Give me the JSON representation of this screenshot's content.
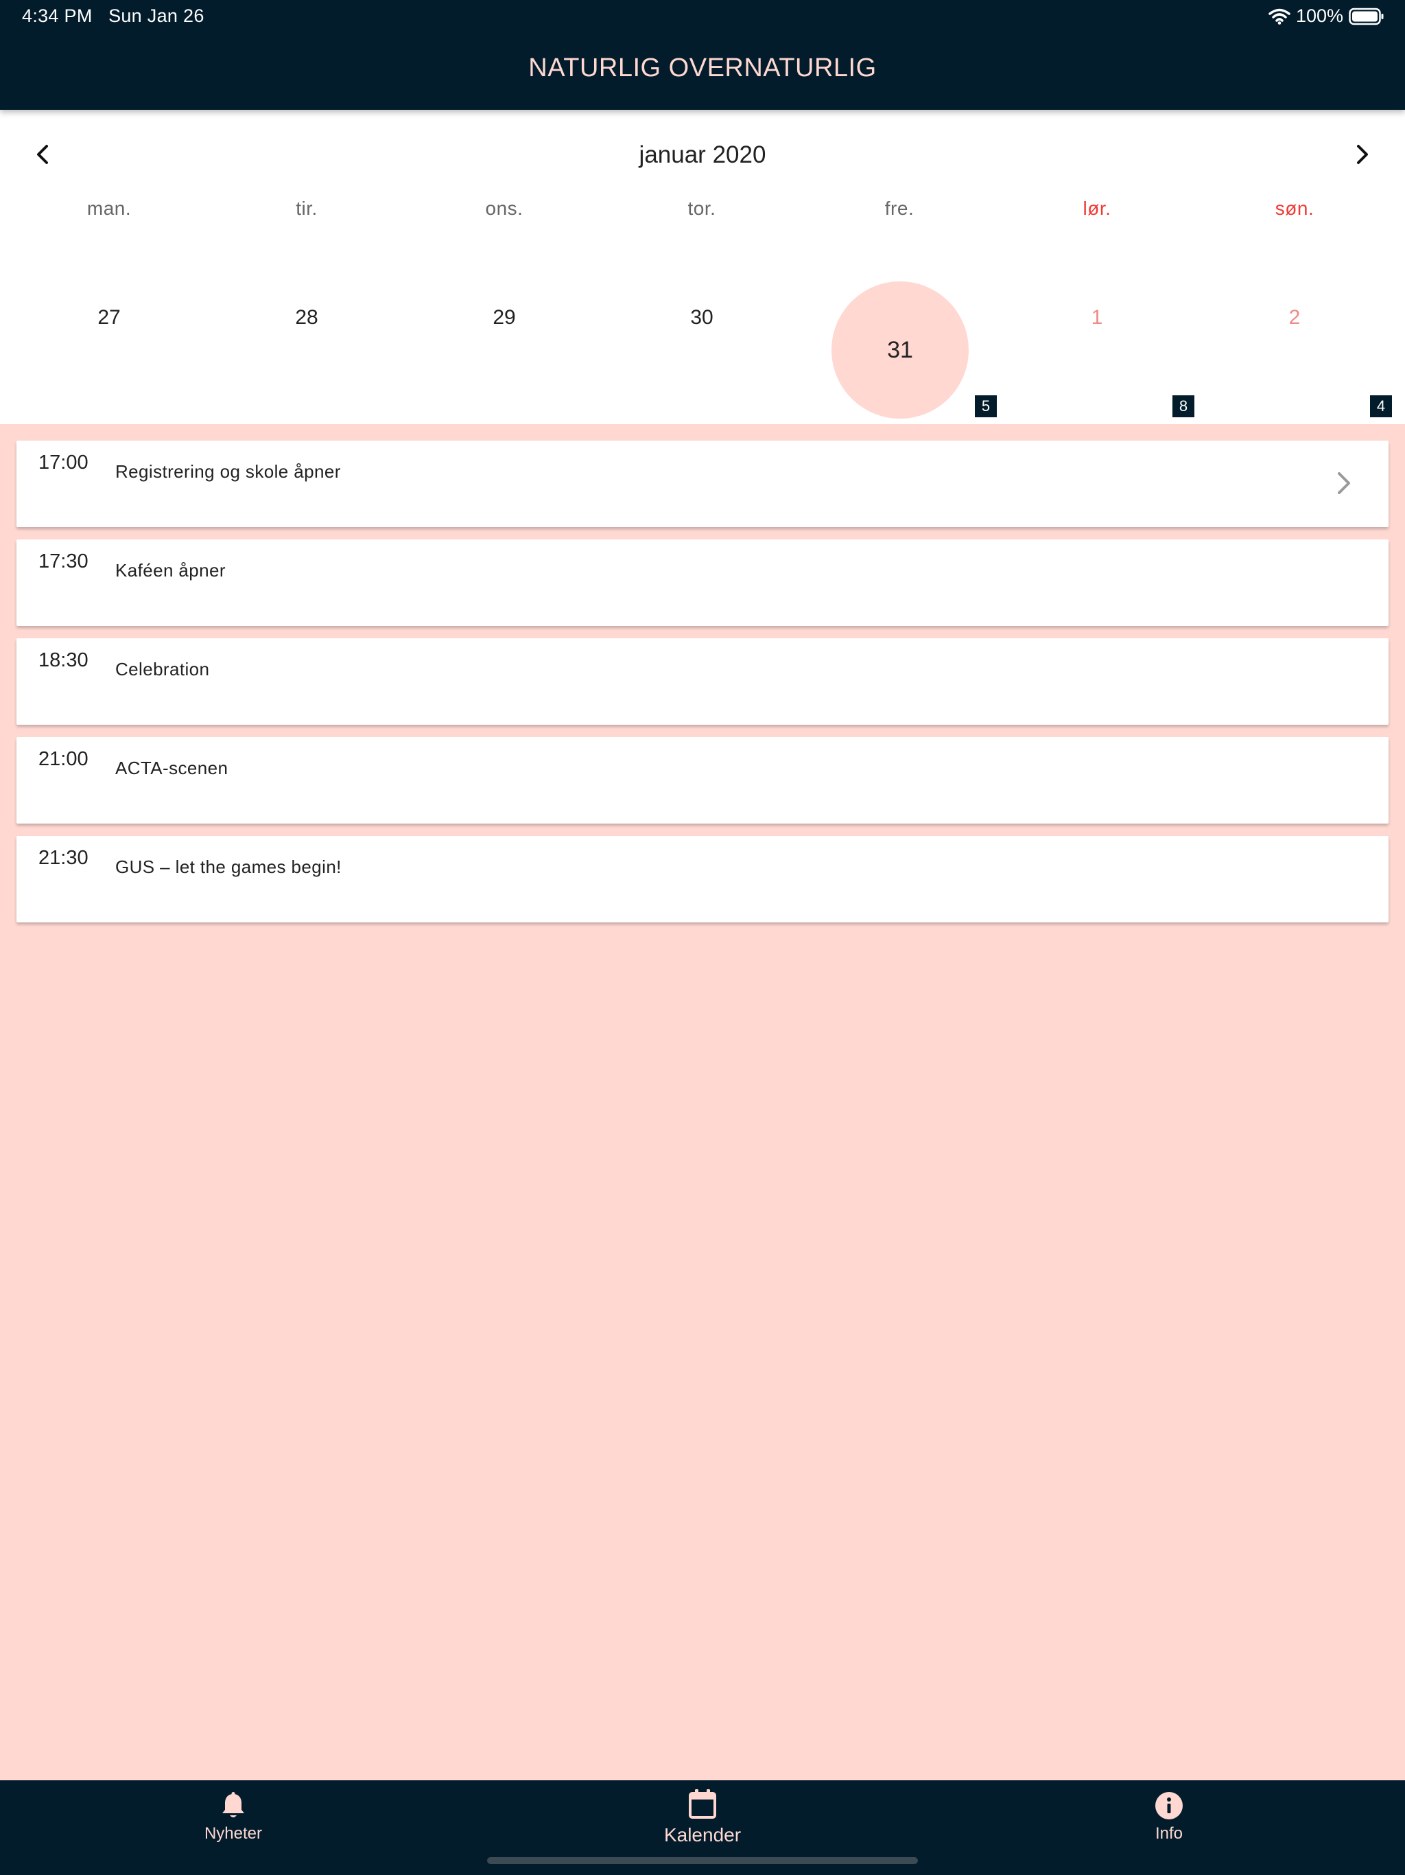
{
  "status_bar": {
    "time": "4:34 PM",
    "date": "Sun Jan 26",
    "battery": "100%"
  },
  "app": {
    "title": "NATURLIG OVERNATURLIG"
  },
  "calendar": {
    "month": "januar 2020",
    "weekdays": [
      "man.",
      "tir.",
      "ons.",
      "tor.",
      "fre.",
      "lør.",
      "søn."
    ],
    "days": [
      "27",
      "28",
      "29",
      "30",
      "31",
      "1",
      "2"
    ],
    "selected_day": "31",
    "event_counts": [
      "5",
      "8",
      "4"
    ]
  },
  "events": [
    {
      "time": "17:00",
      "title": "Registrering og skole åpner"
    },
    {
      "time": "17:30",
      "title": "Kaféen åpner"
    },
    {
      "time": "18:30",
      "title": "Celebration"
    },
    {
      "time": "21:00",
      "title": "ACTA-scenen"
    },
    {
      "time": "21:30",
      "title": "GUS – let the games begin!"
    }
  ],
  "tabs": {
    "news": "Nyheter",
    "calendar": "Kalender",
    "info": "Info"
  },
  "colors": {
    "header": "#021c2b",
    "accent": "#ffd8d2",
    "weekend": "#ef3b36"
  }
}
